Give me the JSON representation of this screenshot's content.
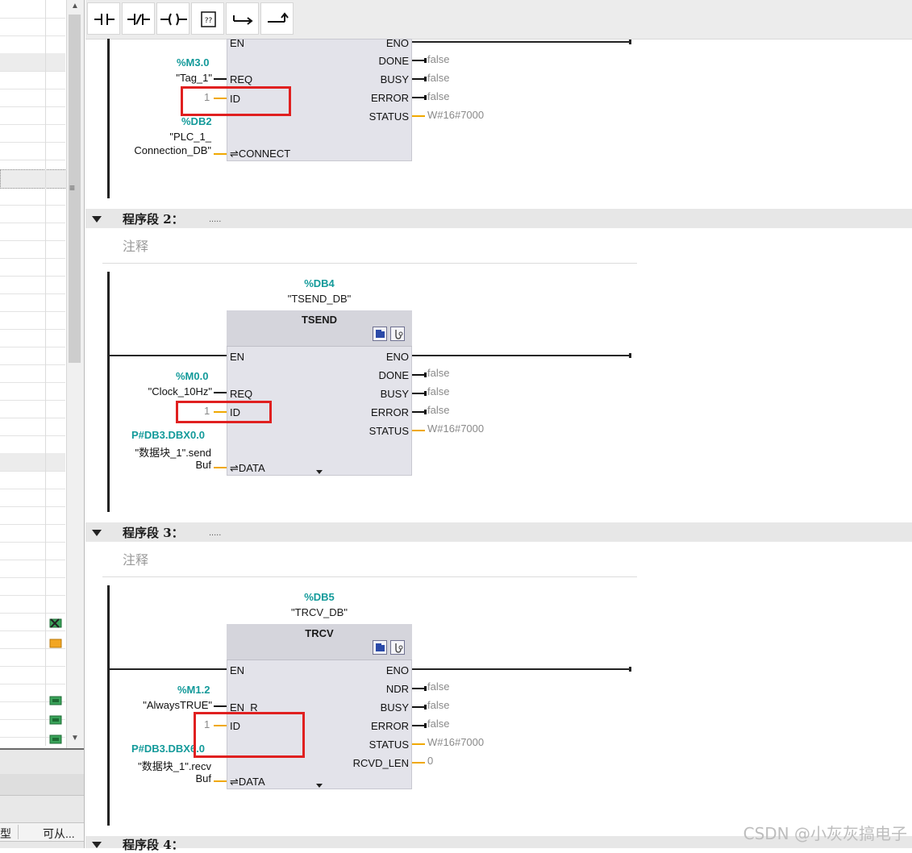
{
  "toolbar": {
    "buttons": [
      {
        "name": "normally-open-contact",
        "icon": "no-contact-icon"
      },
      {
        "name": "normally-closed-contact",
        "icon": "nc-contact-icon"
      },
      {
        "name": "coil",
        "icon": "coil-icon"
      },
      {
        "name": "empty-box",
        "icon": "empty-box-icon",
        "glyph": "??"
      },
      {
        "name": "open-branch",
        "icon": "open-branch-icon"
      },
      {
        "name": "close-branch",
        "icon": "close-branch-icon"
      }
    ]
  },
  "left_panel": {
    "column_headers": [
      "型",
      "可从..."
    ],
    "scroll_marker": "≡"
  },
  "segment1": {
    "in_addr_req": "%M3.0",
    "in_tag_req": "\"Tag_1\"",
    "in_id_val": "1",
    "in_addr_connect": "%DB2",
    "in_tag_connect_1": "\"PLC_1_",
    "in_tag_connect_2": "Connection_DB\"",
    "pins_left": [
      "EN",
      "REQ",
      "ID",
      "⇌CONNECT"
    ],
    "pins_right": [
      "ENO",
      "DONE",
      "BUSY",
      "ERROR",
      "STATUS"
    ],
    "out_vals": [
      "false",
      "false",
      "false",
      "W#16#7000"
    ]
  },
  "segment2": {
    "header": "程序段 2：",
    "dots": ".....",
    "comment": "注释",
    "db_addr": "%DB4",
    "db_name": "\"TSEND_DB\"",
    "block_name": "TSEND",
    "in_addr_req": "%M0.0",
    "in_tag_req": "\"Clock_10Hz\"",
    "in_id_val": "1",
    "in_addr_data": "P#DB3.DBX0.0",
    "in_tag_data_1": "\"数据块_1\".send",
    "in_tag_data_2": "Buf",
    "pins_left": [
      "EN",
      "REQ",
      "ID",
      "⇌DATA"
    ],
    "pins_right": [
      "ENO",
      "DONE",
      "BUSY",
      "ERROR",
      "STATUS"
    ],
    "out_vals": [
      "false",
      "false",
      "false",
      "W#16#7000"
    ]
  },
  "segment3": {
    "header": "程序段 3：",
    "dots": ".....",
    "comment": "注释",
    "db_addr": "%DB5",
    "db_name": "\"TRCV_DB\"",
    "block_name": "TRCV",
    "in_addr_enr": "%M1.2",
    "in_tag_enr": "\"AlwaysTRUE\"",
    "in_id_val": "1",
    "in_addr_data": "P#DB3.DBX6.0",
    "in_tag_data_1": "\"数据块_1\".recv",
    "in_tag_data_2": "Buf",
    "pins_left": [
      "EN",
      "EN_R",
      "ID",
      "⇌DATA"
    ],
    "pins_right": [
      "ENO",
      "NDR",
      "BUSY",
      "ERROR",
      "STATUS",
      "RCVD_LEN"
    ],
    "out_vals": [
      "false",
      "false",
      "false",
      "W#16#7000",
      "0"
    ]
  },
  "segment4": {
    "header": "程序段 4："
  },
  "watermark": "CSDN @小灰灰搞电子",
  "colors": {
    "address_teal": "#139a9a",
    "wire_orange": "#f0a800",
    "highlight_red": "#e02020",
    "block_fill": "#e3e3ea"
  }
}
